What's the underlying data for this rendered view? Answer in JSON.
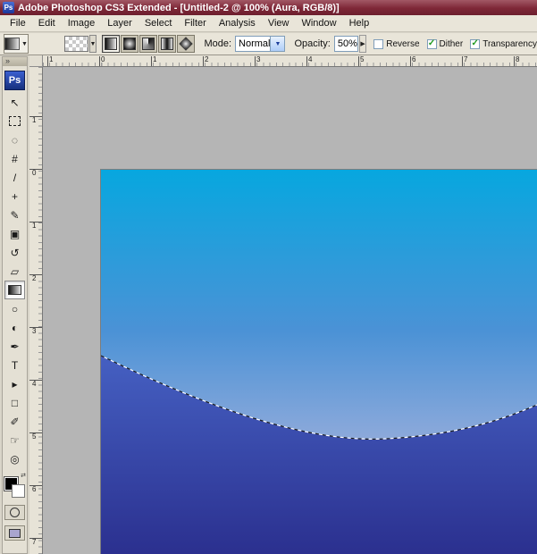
{
  "window": {
    "icon_label": "Ps",
    "title": "Adobe Photoshop CS3 Extended - [Untitled-2 @ 100% (Aura, RGB/8)]"
  },
  "menubar": {
    "items": [
      "File",
      "Edit",
      "Image",
      "Layer",
      "Select",
      "Filter",
      "Analysis",
      "View",
      "Window",
      "Help"
    ]
  },
  "options": {
    "dropdown_glyph": "▼",
    "mode_label": "Mode:",
    "mode_value": "Normal",
    "opacity_label": "Opacity:",
    "opacity_value": "50%",
    "spin_glyph": "▶",
    "gradient_types": [
      "linear",
      "radial",
      "angle",
      "reflected",
      "diamond"
    ],
    "checkboxes": {
      "reverse": {
        "label": "Reverse",
        "checked": false,
        "mark": ""
      },
      "dither": {
        "label": "Dither",
        "checked": true,
        "mark": "✓"
      },
      "transparency": {
        "label": "Transparency",
        "checked": true,
        "mark": "✓"
      }
    }
  },
  "toolbar": {
    "collapse_glyph": "»",
    "logo": "Ps",
    "swap_glyph": "⇄",
    "tools": [
      {
        "name": "move-tool",
        "glyph": "↖"
      },
      {
        "name": "rectangular-marquee-tool",
        "glyph": ""
      },
      {
        "name": "lasso-tool",
        "glyph": "◌"
      },
      {
        "name": "crop-tool",
        "glyph": "#"
      },
      {
        "name": "slice-tool",
        "glyph": "/"
      },
      {
        "name": "healing-brush-tool",
        "glyph": "+"
      },
      {
        "name": "brush-tool",
        "glyph": "✎"
      },
      {
        "name": "clone-stamp-tool",
        "glyph": "▣"
      },
      {
        "name": "history-brush-tool",
        "glyph": "↺"
      },
      {
        "name": "eraser-tool",
        "glyph": "▱"
      },
      {
        "name": "gradient-tool",
        "glyph": "",
        "selected": true
      },
      {
        "name": "blur-tool",
        "glyph": "○"
      },
      {
        "name": "dodge-tool",
        "glyph": "◐"
      },
      {
        "name": "pen-tool",
        "glyph": "✒"
      },
      {
        "name": "type-tool",
        "glyph": "T"
      },
      {
        "name": "path-selection-tool",
        "glyph": "▸"
      },
      {
        "name": "shape-tool",
        "glyph": "□"
      },
      {
        "name": "eyedropper-tool",
        "glyph": "✐"
      },
      {
        "name": "hand-tool",
        "glyph": "☞"
      },
      {
        "name": "zoom-tool",
        "glyph": "◎"
      }
    ]
  },
  "rulers": {
    "horizontal": [
      "1",
      "0",
      "1",
      "2",
      "3",
      "4",
      "5",
      "6",
      "7",
      "8"
    ],
    "vertical": [
      "1",
      "0",
      "1",
      "2",
      "3",
      "4",
      "5",
      "6",
      "7"
    ]
  },
  "canvas": {
    "document": "Untitled-2",
    "zoom": "100%",
    "layer": "Aura",
    "color_mode": "RGB/8",
    "selection": "curved marching-ants selection across canvas",
    "colors": {
      "sky_top": "#07a7df",
      "sky_mid": "#4b92d6",
      "sky_light": "#9fb0dc",
      "lower_top": "#4560c2",
      "lower_bottom": "#2b308f"
    }
  }
}
